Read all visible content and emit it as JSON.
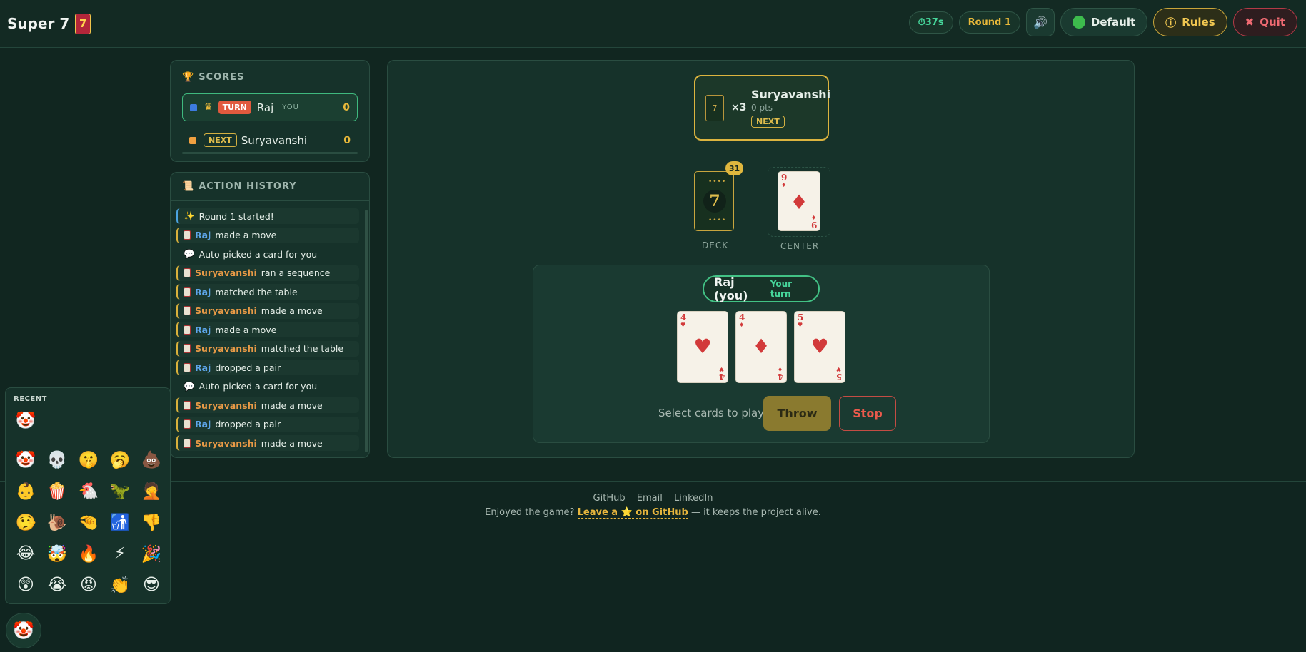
{
  "header": {
    "title": "Super 7",
    "logo_digit": "7",
    "timer": "37s",
    "round": "Round 1",
    "theme_label": "Default",
    "rules_label": "Rules",
    "quit_label": "Quit",
    "icons": {
      "timer": "⏱",
      "sound": "🔊",
      "theme": "green-circle",
      "rules": "ⓘ",
      "quit": "✖"
    }
  },
  "scores": {
    "title": "SCORES",
    "icon": "🏆",
    "players": [
      {
        "name": "Raj",
        "badge": "TURN",
        "you_tag": "YOU",
        "score": "0",
        "color": "#3d7be0",
        "crown": "♛"
      },
      {
        "name": "Suryavanshi",
        "badge": "NEXT",
        "score": "0",
        "color": "#f0a040"
      }
    ]
  },
  "history": {
    "title": "ACTION HISTORY",
    "icon": "📜",
    "items": [
      {
        "kind": "round",
        "icon": "✨",
        "text": "Round 1 started!"
      },
      {
        "kind": "move",
        "player": "Raj",
        "text": "made a move"
      },
      {
        "kind": "sys",
        "icon": "💬",
        "text": "Auto-picked a card for you"
      },
      {
        "kind": "move",
        "player": "Suryavanshi",
        "text": "ran a sequence"
      },
      {
        "kind": "move",
        "player": "Raj",
        "text": "matched the table"
      },
      {
        "kind": "move",
        "player": "Suryavanshi",
        "text": "made a move"
      },
      {
        "kind": "move",
        "player": "Raj",
        "text": "made a move"
      },
      {
        "kind": "move",
        "player": "Suryavanshi",
        "text": "matched the table"
      },
      {
        "kind": "move",
        "player": "Raj",
        "text": "dropped a pair"
      },
      {
        "kind": "sys",
        "icon": "💬",
        "text": "Auto-picked a card for you"
      },
      {
        "kind": "move",
        "player": "Suryavanshi",
        "text": "made a move"
      },
      {
        "kind": "move",
        "player": "Raj",
        "text": "dropped a pair"
      },
      {
        "kind": "move",
        "player": "Suryavanshi",
        "text": "made a move"
      }
    ]
  },
  "board": {
    "opponent": {
      "name": "Suryavanshi",
      "points": "0 pts",
      "badge": "NEXT",
      "card_count": "×3",
      "card_digit": "7"
    },
    "deck": {
      "label": "DECK",
      "count": "31",
      "digit": "7"
    },
    "center": {
      "label": "CENTER",
      "card": {
        "rank": "9",
        "suit": "♦"
      }
    },
    "player": {
      "name": "Raj (you)",
      "status": "Your turn"
    },
    "hand": [
      {
        "rank": "4",
        "suit": "♥"
      },
      {
        "rank": "4",
        "suit": "♦"
      },
      {
        "rank": "5",
        "suit": "♥"
      }
    ],
    "hint": "Select cards to play",
    "throw_label": "Throw",
    "stop_label": "Stop"
  },
  "footer": {
    "links": [
      "GitHub",
      "Email",
      "LinkedIn"
    ],
    "note_before": "Enjoyed the game?",
    "note_link": "Leave a ⭐ on GitHub",
    "note_after": "— it keeps the project alive."
  },
  "emoji_picker": {
    "recent_label": "RECENT",
    "recent": [
      "🤡"
    ],
    "grid": [
      "🤡",
      "💀",
      "🤫",
      "🥱",
      "💩",
      "👶",
      "🍿",
      "🐔",
      "🦖",
      "🤦",
      "🤥",
      "🐌",
      "🤏",
      "🚮",
      "👎",
      "😂",
      "🤯",
      "🔥",
      "⚡",
      "🎉",
      "😲",
      "😭",
      "😡",
      "👏",
      "😎"
    ],
    "fab": "🤡"
  },
  "colors": {
    "accent_gold": "#e0b73e",
    "accent_green": "#42c285",
    "danger": "#e15a3e"
  }
}
